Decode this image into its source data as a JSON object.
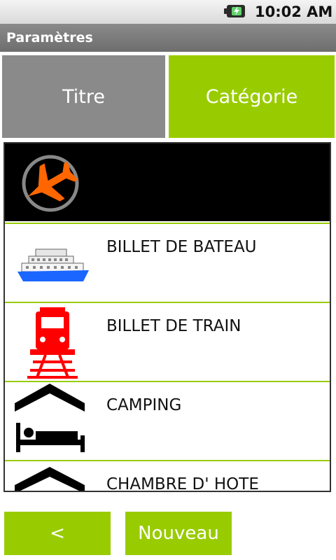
{
  "status_bar": {
    "time": "10:02 AM",
    "battery_icon": "battery-charging-icon"
  },
  "title_bar": {
    "title": "Paramètres"
  },
  "tabs": [
    {
      "label": "Titre",
      "selected": false
    },
    {
      "label": "Catégorie",
      "selected": true
    }
  ],
  "categories": [
    {
      "label": "",
      "icon": "airplane-icon",
      "selected": true
    },
    {
      "label": "BILLET DE BATEAU",
      "icon": "ship-icon",
      "selected": false
    },
    {
      "label": "BILLET DE TRAIN",
      "icon": "train-icon",
      "selected": false
    },
    {
      "label": "CAMPING",
      "icon": "tent-bed-icon",
      "selected": false
    },
    {
      "label": "CHAMBRE D' HOTE",
      "icon": "roof-icon",
      "selected": false
    }
  ],
  "buttons": {
    "back_label": "<",
    "new_label": "Nouveau"
  },
  "colors": {
    "accent": "#99cc00",
    "tab_inactive": "#8a8a8a",
    "selected_row": "#000000",
    "airplane": "#ff6600",
    "train": "#ff0000",
    "ship_hull": "#1a66ff"
  }
}
